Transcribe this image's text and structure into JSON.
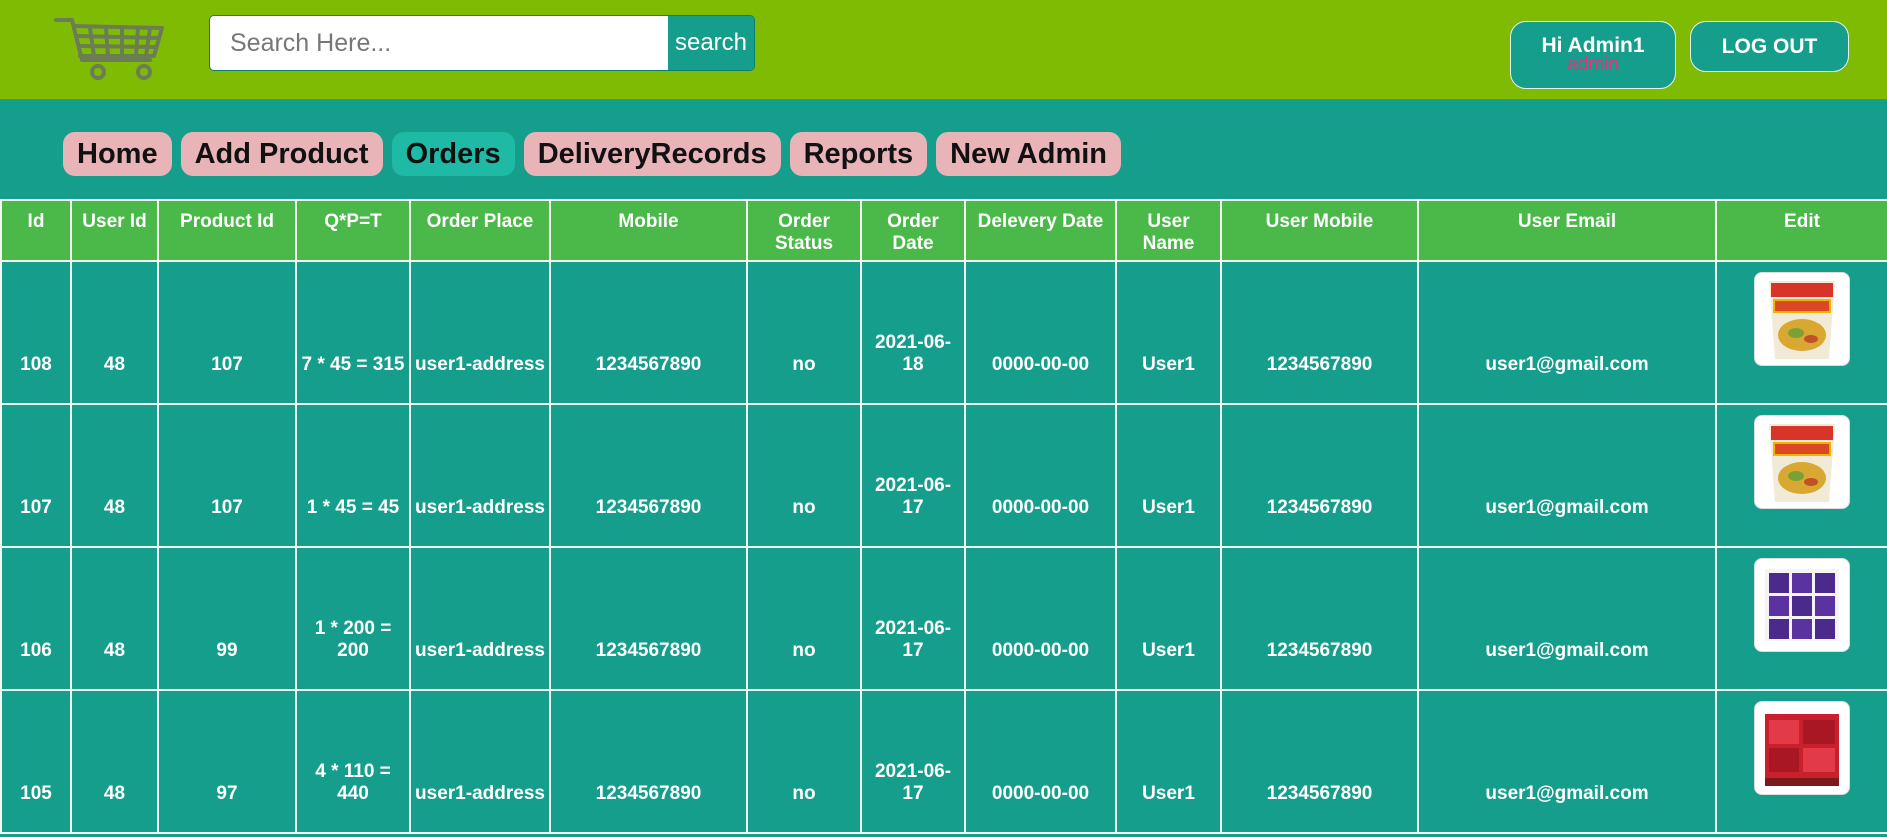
{
  "header": {
    "logo_icon": "shopping-cart-icon",
    "search": {
      "placeholder": "Search Here...",
      "value": "",
      "button_label": "search"
    },
    "greeting": {
      "text": "Hi Admin1",
      "role": "admin"
    },
    "logout_label": "LOG OUT"
  },
  "nav": [
    {
      "label": "Home",
      "active": false
    },
    {
      "label": "Add Product",
      "active": false
    },
    {
      "label": "Orders",
      "active": true
    },
    {
      "label": "DeliveryRecords",
      "active": false
    },
    {
      "label": "Reports",
      "active": false
    },
    {
      "label": "New Admin",
      "active": false
    }
  ],
  "table": {
    "columns": [
      "Id",
      "User Id",
      "Product Id",
      "Q*P=T",
      "Order Place",
      "Mobile",
      "Order Status",
      "Order Date",
      "Delevery Date",
      "User Name",
      "User Mobile",
      "User Email",
      "Edit"
    ],
    "rows": [
      {
        "id": "108",
        "user_id": "48",
        "product_id": "107",
        "qpt": "7 * 45 = 315",
        "place": "user1-address",
        "mobile": "1234567890",
        "status": "no",
        "order_date": "2021-06-18",
        "delivery_date": "0000-00-00",
        "user_name": "User1",
        "user_mobile": "1234567890",
        "user_email": "user1@gmail.com",
        "image": "noodle-cup-image"
      },
      {
        "id": "107",
        "user_id": "48",
        "product_id": "107",
        "qpt": "1 * 45 = 45",
        "place": "user1-address",
        "mobile": "1234567890",
        "status": "no",
        "order_date": "2021-06-17",
        "delivery_date": "0000-00-00",
        "user_name": "User1",
        "user_mobile": "1234567890",
        "user_email": "user1@gmail.com",
        "image": "noodle-cup-image"
      },
      {
        "id": "106",
        "user_id": "48",
        "product_id": "99",
        "qpt": "1 * 200 = 200",
        "place": "user1-address",
        "mobile": "1234567890",
        "status": "no",
        "order_date": "2021-06-17",
        "delivery_date": "0000-00-00",
        "user_name": "User1",
        "user_mobile": "1234567890",
        "user_email": "user1@gmail.com",
        "image": "purple-packets-image"
      },
      {
        "id": "105",
        "user_id": "48",
        "product_id": "97",
        "qpt": "4 * 110 = 440",
        "place": "user1-address",
        "mobile": "1234567890",
        "status": "no",
        "order_date": "2021-06-17",
        "delivery_date": "0000-00-00",
        "user_name": "User1",
        "user_mobile": "1234567890",
        "user_email": "user1@gmail.com",
        "image": "red-snack-image"
      }
    ]
  },
  "colors": {
    "header_bg": "#80bb04",
    "page_bg": "#169e8c",
    "table_header_bg": "#4bb94a",
    "nav_item_bg": "#e8b4b8",
    "nav_active_bg": "#1ebaa5",
    "role_text": "#e0357a"
  }
}
